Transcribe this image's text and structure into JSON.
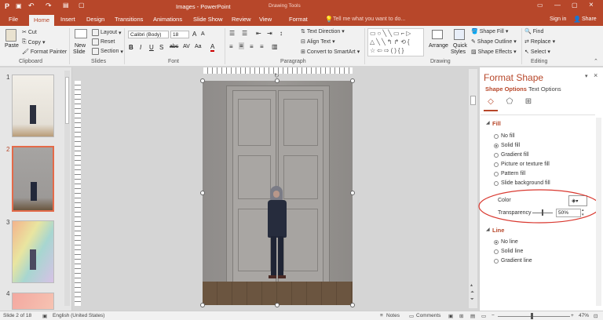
{
  "window": {
    "title": "Images - PowerPoint",
    "context_label": "Drawing Tools",
    "sign_in": "Sign in",
    "share": "Share"
  },
  "tabs": [
    "File",
    "Home",
    "Insert",
    "Design",
    "Transitions",
    "Animations",
    "Slide Show",
    "Review",
    "View",
    "Format"
  ],
  "tell_me": "Tell me what you want to do...",
  "ribbon": {
    "clipboard": {
      "label": "Clipboard",
      "paste": "Paste",
      "cut": "Cut",
      "copy": "Copy",
      "format_painter": "Format Painter"
    },
    "slides": {
      "label": "Slides",
      "new_slide": "New",
      "new_slide2": "Slide",
      "layout": "Layout",
      "reset": "Reset",
      "section": "Section"
    },
    "font": {
      "label": "Font",
      "family": "Calibri (Body)",
      "size": "18"
    },
    "paragraph": {
      "label": "Paragraph",
      "text_direction": "Text Direction",
      "align_text": "Align Text",
      "smartart": "Convert to SmartArt"
    },
    "drawing": {
      "label": "Drawing",
      "arrange": "Arrange",
      "quick_styles": "Quick",
      "quick_styles2": "Styles",
      "shape_fill": "Shape Fill",
      "shape_outline": "Shape Outline",
      "shape_effects": "Shape Effects"
    },
    "editing": {
      "label": "Editing",
      "find": "Find",
      "replace": "Replace",
      "select": "Select"
    }
  },
  "thumbnails": [
    "1",
    "2",
    "3",
    "4"
  ],
  "format_pane": {
    "title": "Format Shape",
    "tab_shape": "Shape Options",
    "tab_text": "Text Options",
    "fill_header": "Fill",
    "fill_options": [
      "No fill",
      "Solid fill",
      "Gradient fill",
      "Picture or texture fill",
      "Pattern fill",
      "Slide background fill"
    ],
    "fill_selected": 1,
    "color_label": "Color",
    "transparency_label": "Transparency",
    "transparency_value": "50%",
    "line_header": "Line",
    "line_options": [
      "No line",
      "Solid line",
      "Gradient line"
    ],
    "line_selected": 0
  },
  "status": {
    "slide": "Slide 2 of 18",
    "language": "English (United States)",
    "notes": "Notes",
    "comments": "Comments",
    "zoom": "47%"
  },
  "colors": {
    "accent": "#b7472a",
    "highlight_circle": "#d9382f"
  }
}
